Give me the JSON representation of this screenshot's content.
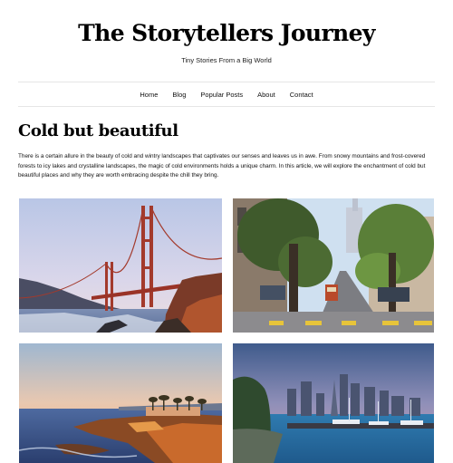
{
  "site": {
    "title": "The Storytellers Journey",
    "tagline": "Tiny Stories From a Big World"
  },
  "nav": {
    "items": [
      {
        "label": "Home"
      },
      {
        "label": "Blog"
      },
      {
        "label": "Popular Posts"
      },
      {
        "label": "About"
      },
      {
        "label": "Contact"
      }
    ]
  },
  "post": {
    "title": "Cold but beautiful",
    "intro": "There is a certain allure in the beauty of cold and wintry landscapes that captivates our senses and leaves us in awe. From snowy mountains and frost-covered forests to icy lakes and crystalline landscapes, the magic of cold environments holds a unique charm. In this article, we will explore the enchantment of cold but beautiful places and why they are worth embracing despite the chill they bring."
  },
  "gallery": {
    "images": [
      {
        "icon": "golden-gate-bridge-photo"
      },
      {
        "icon": "city-street-cable-car-photo"
      },
      {
        "icon": "rocky-coast-sunset-photo"
      },
      {
        "icon": "harbor-skyline-photo"
      }
    ]
  }
}
